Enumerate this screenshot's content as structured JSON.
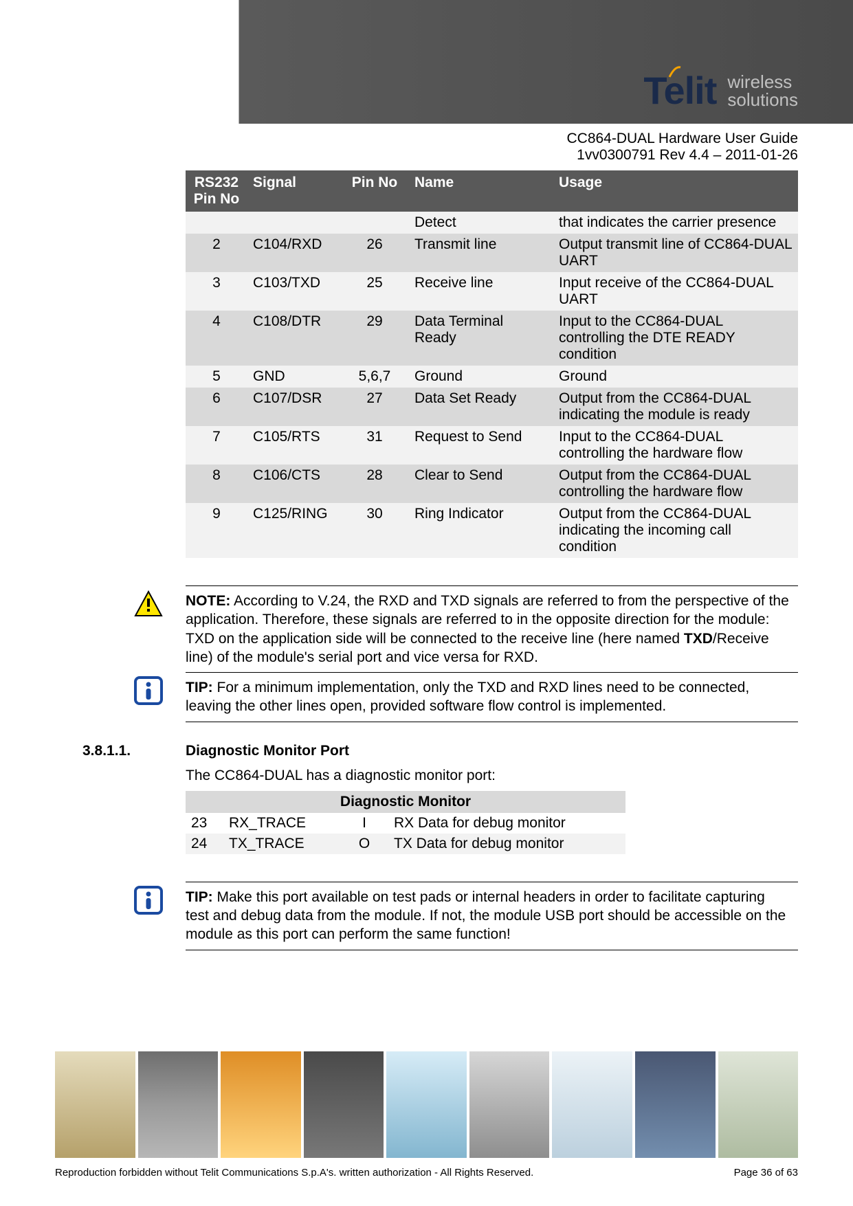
{
  "header": {
    "brand": "Telit",
    "tagline_line1": "wireless",
    "tagline_line2": "solutions"
  },
  "doc": {
    "title": "CC864-DUAL Hardware User Guide",
    "rev": "1vv0300791 Rev 4.4 – 2011-01-26"
  },
  "rs232_table": {
    "headers": {
      "rs_pin": "RS232 Pin No",
      "signal": "Signal",
      "pin_no": "Pin No",
      "name": "Name",
      "usage": "Usage"
    },
    "rows": [
      {
        "rs": "",
        "signal": "",
        "pin": "",
        "name": "Detect",
        "usage": "that indicates the carrier presence"
      },
      {
        "rs": "2",
        "signal": "C104/RXD",
        "pin": "26",
        "name": "Transmit line",
        "usage": "Output transmit line of CC864-DUAL UART"
      },
      {
        "rs": "3",
        "signal": "C103/TXD",
        "pin": "25",
        "name": "Receive line",
        "usage": "Input receive of the CC864-DUAL UART"
      },
      {
        "rs": "4",
        "signal": "C108/DTR",
        "pin": "29",
        "name": "Data Terminal Ready",
        "usage": "Input to the CC864-DUAL controlling the DTE READY condition"
      },
      {
        "rs": "5",
        "signal": "GND",
        "pin": "5,6,7",
        "name": "Ground",
        "usage": "Ground"
      },
      {
        "rs": "6",
        "signal": "C107/DSR",
        "pin": "27",
        "name": "Data Set Ready",
        "usage": "Output from the CC864-DUAL indicating the module is ready"
      },
      {
        "rs": "7",
        "signal": "C105/RTS",
        "pin": "31",
        "name": "Request to Send",
        "usage": "Input to the CC864-DUAL controlling the hardware flow"
      },
      {
        "rs": "8",
        "signal": "C106/CTS",
        "pin": "28",
        "name": "Clear to Send",
        "usage": "Output from the CC864-DUAL controlling the hardware flow"
      },
      {
        "rs": "9",
        "signal": "C125/RING",
        "pin": "30",
        "name": "Ring Indicator",
        "usage": "Output from the CC864-DUAL indicating the incoming call condition"
      }
    ]
  },
  "note": {
    "label": "NOTE:",
    "text_before": " According to V.24, the RXD and TXD signals are referred to from the perspective of the application. Therefore, these signals are referred to in the opposite direction for the module: TXD on the application side will be connected to the receive line (here named ",
    "bold_mid": "TXD",
    "text_after": "/Receive line) of the module's serial port and vice versa for RXD."
  },
  "tip1": {
    "label": "TIP:",
    "text": " For a minimum implementation, only the TXD and RXD lines need to be connected, leaving the other lines open, provided software flow control is implemented."
  },
  "section": {
    "num": "3.8.1.1.",
    "title": "Diagnostic Monitor Port",
    "intro": "The CC864-DUAL has a diagnostic monitor port:"
  },
  "diag_table": {
    "header": "Diagnostic Monitor",
    "rows": [
      {
        "pin": "23",
        "signal": "RX_TRACE",
        "io": "I",
        "desc": "RX Data for debug monitor"
      },
      {
        "pin": "24",
        "signal": "TX_TRACE",
        "io": "O",
        "desc": "TX Data for debug monitor"
      }
    ]
  },
  "tip2": {
    "label": "TIP:",
    "text": " Make this port available on test pads or internal headers in order to facilitate capturing test and debug data from the module. If not, the module USB port should be accessible on the module as this port can perform the same function!"
  },
  "footer": {
    "left": "Reproduction forbidden without Telit Communications S.p.A's. written authorization - All Rights Reserved.",
    "right": "Page 36 of 63"
  }
}
